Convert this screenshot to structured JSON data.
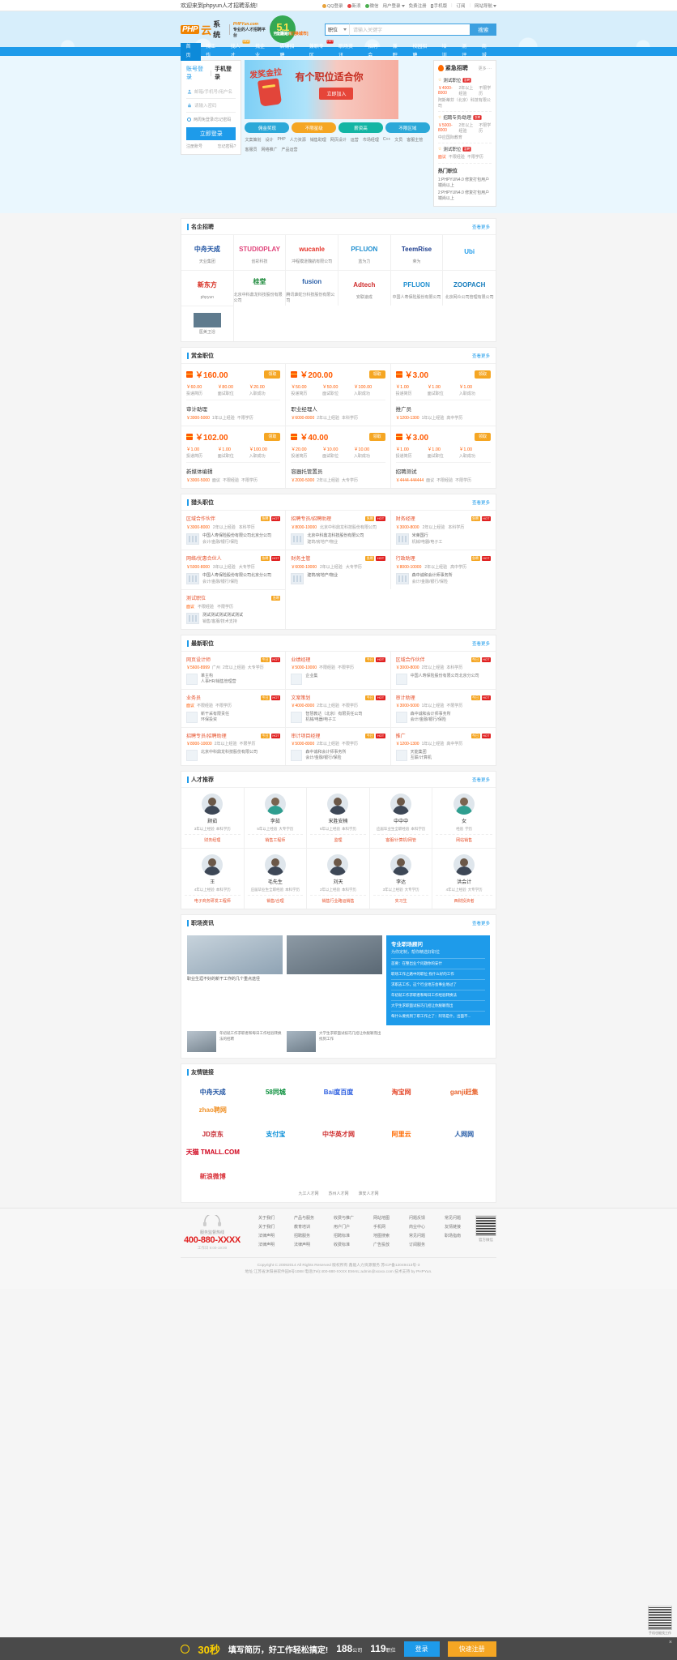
{
  "topbar": {
    "welcome": "欢迎来到phpyun人才招聘系统!",
    "links": [
      {
        "label": "QQ登录",
        "icon": "qq-icon"
      },
      {
        "label": "新浪",
        "icon": "sina-icon"
      },
      {
        "label": "微信",
        "icon": "wechat-icon"
      },
      {
        "label": "用户登录",
        "icon": "chevron-down-icon"
      },
      {
        "label": "免费注册",
        "icon": ""
      },
      {
        "label": "手机版",
        "icon": "phone-icon"
      },
      {
        "label": "订阅",
        "icon": ""
      },
      {
        "label": "网站导航",
        "icon": "chevron-down-icon"
      }
    ]
  },
  "header": {
    "logo_php": "PHP",
    "logo_yun": "云",
    "logo_sys": "系统",
    "logo_site": "PHPYun.com",
    "logo_slogan": "专业的人才招聘平台",
    "badge_number": "5.1",
    "badge_text": "劳动最光荣",
    "city": "全国站",
    "city_switch": "[切换城市]",
    "search_select": "职位",
    "search_placeholder": "请输入关键字",
    "search_button": "搜索"
  },
  "nav": {
    "items": [
      {
        "label": "首页",
        "active": true,
        "tag": ""
      },
      {
        "label": "找工作",
        "active": false,
        "tag": ""
      },
      {
        "label": "找人才",
        "active": false,
        "tag": "NEW"
      },
      {
        "label": "找企业",
        "active": false,
        "tag": ""
      },
      {
        "label": "店铺招聘",
        "active": false,
        "tag": ""
      },
      {
        "label": "兼职专区",
        "active": false,
        "tag": "HOT"
      },
      {
        "label": "职场资讯",
        "active": false,
        "tag": ""
      },
      {
        "label": "招聘会",
        "active": false,
        "tag": ""
      },
      {
        "label": "兼职",
        "active": false,
        "tag": ""
      },
      {
        "label": "校园招聘",
        "active": false,
        "tag": ""
      },
      {
        "label": "培训",
        "active": false,
        "tag": ""
      },
      {
        "label": "测评",
        "active": false,
        "tag": ""
      },
      {
        "label": "商城",
        "active": false,
        "tag": ""
      }
    ]
  },
  "login": {
    "tab_account": "账号登录",
    "tab_mobile": "手机登录",
    "user_placeholder": "邮箱/手机号/用户名",
    "pass_placeholder": "请输入密码",
    "remember": "两周免登录/忘记密码",
    "submit": "立即登录",
    "link_register": "注册账号",
    "link_forgot": "忘记密码?"
  },
  "hero": {
    "sale_text": "发奖金拉",
    "title": "有个职位适合你",
    "button": "立即加入",
    "tags": [
      {
        "label": "佣金奖现",
        "style": "blue"
      },
      {
        "label": "不限星级",
        "style": "orange"
      },
      {
        "label": "薪资高",
        "style": "teal"
      },
      {
        "label": "不限区域",
        "style": "blue"
      }
    ],
    "cats_row1": [
      "文案策划",
      "设计",
      "PHP",
      "人力资源",
      "销售助理"
    ],
    "cats_row2": [
      "网页设计",
      "运营",
      "市场经理",
      "C++",
      "文员",
      "客服主管"
    ],
    "cats_row3": [
      "客服员",
      "网络推广",
      "产品运营"
    ]
  },
  "urgent": {
    "title": "紧急招聘",
    "more": "更多 ···",
    "items": [
      {
        "name": "测试职位",
        "tag": "急聘",
        "salary": "￥4000-8000",
        "exp": "2年以上经验",
        "edu": "不限学历",
        "company": "阿斯蒂芬（北京）科技有限公司"
      },
      {
        "name": "招聘专员/助理",
        "tag": "急聘",
        "salary": "￥5000-8000",
        "exp": "2年以上经验",
        "edu": "不限学历",
        "company": "中应国际教育"
      },
      {
        "name": "测试职位",
        "tag": "急聘",
        "salary": "面议",
        "exp": "不限经验",
        "edu": "不限学历",
        "company": ""
      }
    ],
    "bottom_title": "热门职位",
    "bottom_items": [
      "1:PHPYUN4.0 修复打包用户端尚以上",
      "2:PHPYUN4.0 修复打包用户端尚以上"
    ]
  },
  "famous": {
    "title": "名企招聘",
    "more": "查看更多",
    "rows": [
      [
        {
          "logo": "中舟天成",
          "color": "#1a4fa0",
          "name": "天业集团"
        },
        {
          "logo": "STUDIOPLAY",
          "color": "#e0437a",
          "name": "创彩科技"
        },
        {
          "logo": "wucanle",
          "color": "#e63329",
          "name": "冲程模逊魏航有限公司"
        },
        {
          "logo": "PFLUON",
          "color": "#1f8fd0",
          "name": "蓝为力"
        },
        {
          "logo": "TeemRise",
          "color": "#1f3f8f",
          "name": "荣为"
        },
        {
          "logo": "Ubi",
          "color": "#1e9bea",
          "name": ""
        }
      ],
      [
        {
          "logo": "新东方",
          "color": "#d62a1e",
          "name": "phpyun"
        },
        {
          "logo": "桂堂",
          "color": "#1e8a3c",
          "name": "北京中科鼎龙科技股份有限公司"
        },
        {
          "logo": "fusion",
          "color": "#2a5fa8",
          "name": "腾讯谁蛇分科技股份有限公司"
        },
        {
          "logo": "Adtech",
          "color": "#cf2e2e",
          "name": "安联速成"
        },
        {
          "logo": "PFLUON",
          "color": "#1f8fd0",
          "name": "中国人寿保险股份有限公司"
        },
        {
          "logo": "ZOOPACH",
          "color": "#1a7fbe",
          "name": "北京网众公司管理有限公司"
        }
      ]
    ],
    "last_row": [
      {
        "logo": "",
        "color": "#2f5d80",
        "name": "医美卫浴"
      }
    ]
  },
  "bounty": {
    "title": "赏金职位",
    "more": "查看更多",
    "items": [
      {
        "price": "￥160.00",
        "tag": "领取",
        "splits": [
          {
            "v": "￥60.00",
            "k": "投递简历"
          },
          {
            "v": "￥80.00",
            "k": "面试职位"
          },
          {
            "v": "￥20.00",
            "k": "入职成功"
          }
        ],
        "job": "审计助理",
        "salary": "￥3000-5000",
        "exp": "1年以上经验",
        "edu": "不限学历"
      },
      {
        "price": "￥200.00",
        "tag": "领取",
        "splits": [
          {
            "v": "￥50.00",
            "k": "投递简历"
          },
          {
            "v": "￥50.00",
            "k": "面试职位"
          },
          {
            "v": "￥100.00",
            "k": "入职成功"
          }
        ],
        "job": "职业经理人",
        "salary": "￥6000-8000",
        "exp": "2年以上经验",
        "edu": "本科学历"
      },
      {
        "price": "￥3.00",
        "tag": "领取",
        "splits": [
          {
            "v": "￥1.00",
            "k": "投递简历"
          },
          {
            "v": "￥1.00",
            "k": "面试职位"
          },
          {
            "v": "￥1.00",
            "k": "入职成功"
          }
        ],
        "job": "推广员",
        "salary": "￥1200-1300",
        "exp": "1年以上经验",
        "edu": "高中学历"
      },
      {
        "price": "￥102.00",
        "tag": "领取",
        "splits": [
          {
            "v": "￥1.00",
            "k": "投递简历"
          },
          {
            "v": "￥1.00",
            "k": "面试职位"
          },
          {
            "v": "￥100.00",
            "k": "入职成功"
          }
        ],
        "job": "新媒体编辑",
        "salary": "￥3000-5000",
        "exp": "面议",
        "exp2": "不限经验",
        "edu": "不限学历"
      },
      {
        "price": "￥40.00",
        "tag": "领取",
        "splits": [
          {
            "v": "￥20.00",
            "k": "投递简历"
          },
          {
            "v": "￥10.00",
            "k": "面试职位"
          },
          {
            "v": "￥10.00",
            "k": "入职成功"
          }
        ],
        "job": "容器托管置员",
        "salary": "￥2000-5000",
        "exp": "2年以上经验",
        "edu": "大专学历"
      },
      {
        "price": "￥3.00",
        "tag": "领取",
        "splits": [
          {
            "v": "￥1.00",
            "k": "投递简历"
          },
          {
            "v": "￥1.00",
            "k": "面试职位"
          },
          {
            "v": "￥1.00",
            "k": "入职成功"
          }
        ],
        "job": "招聘测试",
        "salary": "￥4444-444444",
        "exp": "面议",
        "exp2": "不限经验",
        "edu": "不限学历"
      }
    ]
  },
  "hot_jobs": {
    "title": "猎头职位",
    "more": "查看更多",
    "items": [
      {
        "name": "区域合作伙伴",
        "tags": [
          "急聘",
          "HOT"
        ],
        "salary": "￥3000-8000",
        "exp": "2年以上经验",
        "edu": "本科学历",
        "company": "中国人寿保险股份有限公司北京分公司",
        "field": "会计/金融/银行/保险"
      },
      {
        "name": "招聘专员/招聘助理",
        "tags": [
          "急聘",
          "HOT"
        ],
        "salary": "￥8000-10000",
        "exp": "北京中科鼎龙科技股份有限公司",
        "edu": "",
        "company": "北京中科鼎龙科技股份有限公司",
        "field": "建筑/房地产/物业"
      },
      {
        "name": "财务经理",
        "tags": [
          "急聘",
          "HOT"
        ],
        "salary": "￥3000-8000",
        "exp": "2年以上经验",
        "edu": "本科学历",
        "company": "米莱国行",
        "field": "机械/电器/电子工"
      },
      {
        "name": "网络/优惠合伙人",
        "tags": [
          "急聘",
          "HOT"
        ],
        "salary": "￥5000-8000",
        "exp": "3年以上经验",
        "edu": "大专学历",
        "company": "中国人寿保险股份有限公司北京分公司",
        "field": "会计/金融/银行/保险"
      },
      {
        "name": "财务主管",
        "tags": [
          "急聘",
          "HOT"
        ],
        "salary": "￥6000-10000",
        "exp": "2年以上经验",
        "edu": "大专学历",
        "company": "建筑/房地产/物业",
        "field": ""
      },
      {
        "name": "行政助理",
        "tags": [
          "急聘",
          "HOT"
        ],
        "salary": "￥8000-10000",
        "exp": "2年以上经验",
        "edu": "高中学历",
        "company": "森中诚和会计师事务所",
        "field": "会计/金融/银行/保险"
      },
      {
        "name": "测试职位",
        "tags": [
          "急聘"
        ],
        "salary": "面议",
        "exp": "不限经验",
        "edu": "不限学历",
        "company": "测试测试测试测试测试",
        "field": "销售/客服/技术支持"
      }
    ]
  },
  "latest_jobs": {
    "title": "最新职位",
    "more": "查看更多",
    "items": [
      {
        "name": "网页设计师",
        "tags": [
          "今日",
          "HOT"
        ],
        "salary": "￥5600-8999",
        "city": "广州",
        "exp": "2年以上经验",
        "edu": "大专学历",
        "company": "革主构",
        "desc": "人事HR/销售管理营"
      },
      {
        "name": "业绩经理",
        "tags": [
          "今日",
          "HOT"
        ],
        "salary": "￥5000-10000",
        "city": "",
        "exp": "不限经验",
        "edu": "不限学历",
        "company": "企业集",
        "desc": ""
      },
      {
        "name": "区域合作伙伴",
        "tags": [
          "今日",
          "HOT"
        ],
        "salary": "￥3000-8000",
        "city": "",
        "exp": "2年以上经验",
        "edu": "本科学历",
        "company": "中国人寿保险股份有限公司北京分公司",
        "desc": ""
      },
      {
        "name": "业务员",
        "tags": [
          "今日",
          "HOT"
        ],
        "salary": "面议",
        "city": "",
        "exp": "不限经验",
        "edu": "不限学历",
        "company": "新干采有限责任",
        "desc": "环保投资"
      },
      {
        "name": "文案策划",
        "tags": [
          "今日",
          "HOT"
        ],
        "salary": "￥4000-8000",
        "city": "",
        "exp": "2年以上经验",
        "edu": "不限学历",
        "company": "智慧教达（北京）有限责任公司",
        "desc": "机械/电器/电子工"
      },
      {
        "name": "审计助理",
        "tags": [
          "今日",
          "HOT"
        ],
        "salary": "￥3000-5000",
        "city": "",
        "exp": "1年以上经验",
        "edu": "不限学历",
        "company": "森中诚和会计师事务所",
        "desc": "会计/金融/银行/保险"
      },
      {
        "name": "招聘专员/招聘助理",
        "tags": [
          "今日",
          "HOT"
        ],
        "salary": "￥8000-10000",
        "city": "",
        "exp": "2年以上经验",
        "edu": "不限学历",
        "company": "北京中科鼎龙科技股份有限公司",
        "desc": ""
      },
      {
        "name": "审计项目经理",
        "tags": [
          "今日",
          "HOT"
        ],
        "salary": "￥5000-8000",
        "city": "",
        "exp": "2年以上经验",
        "edu": "不限学历",
        "company": "森中诚和会计师事务所",
        "desc": "会计/金融/银行/保险"
      },
      {
        "name": "推广",
        "tags": [
          "今日",
          "HOT"
        ],
        "salary": "￥1200-1300",
        "city": "",
        "exp": "1年以上经验",
        "edu": "高中学历",
        "company": "天能集团",
        "desc": "互联/计算机"
      }
    ]
  },
  "talents": {
    "title": "人才推荐",
    "more": "查看更多",
    "items": [
      {
        "name": "顾茹",
        "exp": "3年以上经验",
        "edu": "本科学历",
        "job": "财务经理",
        "gender": "m"
      },
      {
        "name": "李茹",
        "exp": "5年以上经验",
        "edu": "大专学历",
        "job": "销售工程师",
        "gender": "f"
      },
      {
        "name": "宋胜安楠",
        "exp": "6年以上经验",
        "edu": "本科学历",
        "job": "监理",
        "gender": "m"
      },
      {
        "name": "中中中",
        "exp": "应届毕业生全职经验",
        "edu": "本科学历",
        "job": "客服/计算机/网管",
        "gender": "m"
      },
      {
        "name": "女",
        "exp": "经验",
        "edu": "学历",
        "job": "网站销售",
        "gender": "f"
      },
      {
        "name": "王",
        "exp": "4年以上经验",
        "edu": "本科学历",
        "job": "电子商务研发工程师",
        "gender": "m"
      },
      {
        "name": "毛先生",
        "exp": "应届毕业生全职经验",
        "edu": "本科学历",
        "job": "销售/合理",
        "gender": "m"
      },
      {
        "name": "刘天",
        "exp": "2年以上经验",
        "edu": "本科学历",
        "job": "销售行业路运销售",
        "gender": "m"
      },
      {
        "name": "李达",
        "exp": "3年以上经验",
        "edu": "大专学历",
        "job": "实习生",
        "gender": "m"
      },
      {
        "name": "洪会计",
        "exp": "4年以上经验",
        "edu": "大专学历",
        "job": "西财投资者",
        "gender": "m"
      }
    ]
  },
  "news": {
    "title": "职场资讯",
    "more": "查看更多",
    "big": [
      {
        "caption": "职业生涯不好的新干工作的几个重点途径"
      },
      {
        "caption": ""
      }
    ],
    "small": [
      {
        "text": "年初就工作求职者和每日工作经验转换法的招聘"
      },
      {
        "text": "大学生求职面试技巧几招让你脱颖而出找到工作"
      }
    ],
    "side": {
      "title": "专业职场顾问",
      "subtitle": "为你定制，帮你精选好职位",
      "items": [
        "首要：在整出业个问题你的安什",
        "职场工作之路中的职位 找什么好的工作",
        "求职志工作，这个行业地方会事业地过了",
        "年初就工作求职者和每日工作经验转换法",
        "大学生求职面试技巧几招让你脱颖而出",
        "每什么要找到了职工作之了：阿等是什，出面不..."
      ]
    }
  },
  "friend_links": {
    "title": "友情链接",
    "rows": [
      [
        {
          "label": "中舟天成",
          "color": "#1a4fa0"
        },
        {
          "label": "58同城",
          "color": "#0a8f3c"
        },
        {
          "label": "Bai度百度",
          "color": "#2d5fe0"
        },
        {
          "label": "淘宝网",
          "color": "#e5492c"
        },
        {
          "label": "ganji赶集",
          "color": "#e8622b"
        },
        {
          "label": "zhao聘网",
          "color": "#f0932b"
        }
      ],
      [
        {
          "label": "JD京东",
          "color": "#c5232b"
        },
        {
          "label": "支付宝",
          "color": "#0a8fd8"
        },
        {
          "label": "中华英才网",
          "color": "#cf2c2c"
        },
        {
          "label": "阿里云",
          "color": "#ff6a00"
        },
        {
          "label": "人网网",
          "color": "#2a5fa8"
        },
        {
          "label": "天猫 TMALL.COM",
          "color": "#d0021b"
        }
      ],
      [
        {
          "label": "新浪微博",
          "color": "#d9363e"
        }
      ]
    ],
    "texts": [
      "九江人才网",
      "苏州人才网",
      "淮安人才网"
    ]
  },
  "footer": {
    "hotline_label": "服务监督热线",
    "hotline": "400-880-XXXX",
    "hours": "工作日 9:00-19:00",
    "cols": [
      {
        "items": [
          "关于我们",
          "关于我们",
          "法律声明",
          "法律声明"
        ]
      },
      {
        "items": [
          "产品与服务",
          "教育培训",
          "招聘服务",
          "法律声明"
        ]
      },
      {
        "items": [
          "收费与推广",
          "用户门户",
          "招聘标准",
          "收费标准"
        ]
      },
      {
        "items": [
          "网站地图",
          "手机网",
          "地图搜索",
          "广告投放"
        ]
      },
      {
        "items": [
          "问题反馈",
          "商业中心",
          "常见问题",
          "订阅服务"
        ]
      },
      {
        "items": [
          "常见问题",
          "友情链接",
          "职场指南"
        ]
      }
    ],
    "qr_caption": "官方微信",
    "copyright": "Copyright C 20092014 All Rights Reserved 版权所有 鑫能人力资源服务 苏ICP备12049413号-3",
    "address": "地址:江苏省沐阳县软件园8号1088  电话(Tel):400-880-XXXX EMAIL:admin@xxxxx.com  技术支持 by PHPYun."
  },
  "fixbar": {
    "seconds": "30秒",
    "slogan": "填写简历，好工作轻松搞定!",
    "company_count": "188",
    "company_unit": "公司",
    "job_count": "119",
    "job_unit": "职位",
    "login": "登录",
    "register": "快速注册",
    "close": "×"
  },
  "sideqr": {
    "caption": "手机也能找工作"
  }
}
